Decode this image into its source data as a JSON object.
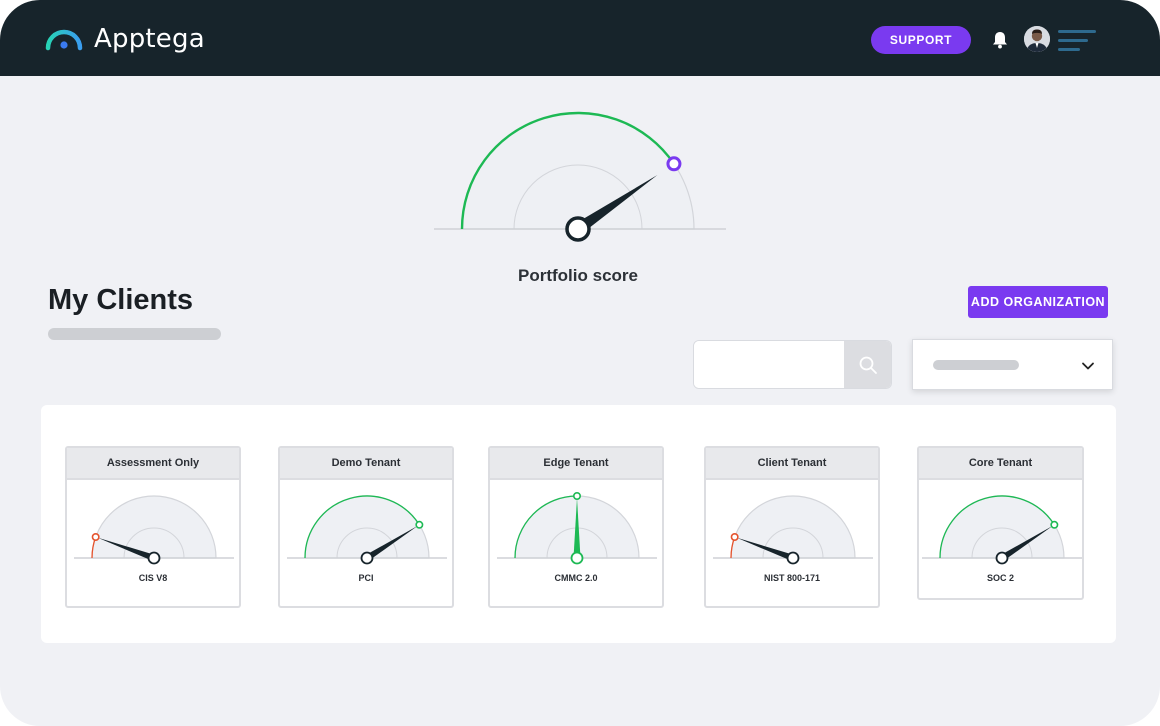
{
  "app": {
    "brand_name": "Apptega"
  },
  "header": {
    "support_label": "SUPPORT",
    "icons": {
      "bell": "bell-icon",
      "menu": "menu-icon",
      "avatar": "user-avatar"
    }
  },
  "colors": {
    "topbar": "#17242b",
    "accent_purple": "#7a3af0",
    "logo_teal": "#27d3b5",
    "logo_blue": "#3a7bf0",
    "gauge_green": "#1db954",
    "gauge_red": "#e5532d",
    "needle": "#17242b",
    "page_bg": "#f0f1f5"
  },
  "portfolio": {
    "label": "Portfolio score",
    "score_fraction": 0.81
  },
  "main": {
    "title": "My Clients",
    "add_button_label": "ADD ORGANIZATION",
    "search": {
      "placeholder": "",
      "icon": "search-icon"
    },
    "filter": {
      "selected": "",
      "icon": "chevron-down-icon"
    }
  },
  "clients": [
    {
      "name": "Assessment Only",
      "framework": "CIS V8",
      "score_fraction": 0.11,
      "status": "red"
    },
    {
      "name": "Demo Tenant",
      "framework": "PCI",
      "score_fraction": 0.82,
      "status": "green"
    },
    {
      "name": "Edge Tenant",
      "framework": "CMMC 2.0",
      "score_fraction": 0.5,
      "status": "green"
    },
    {
      "name": "Client Tenant",
      "framework": "NIST 800-171",
      "score_fraction": 0.11,
      "status": "red"
    },
    {
      "name": "Core Tenant",
      "framework": "SOC 2",
      "score_fraction": 0.82,
      "status": "green"
    }
  ]
}
